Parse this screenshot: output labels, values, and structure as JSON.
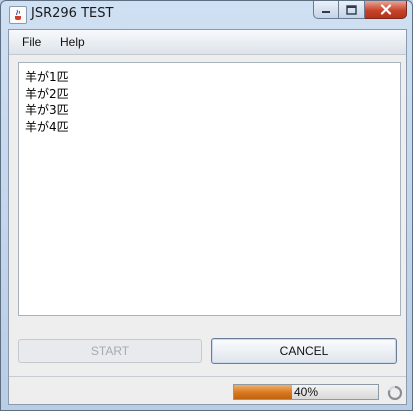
{
  "window": {
    "title": "JSR296 TEST"
  },
  "menu": {
    "items": [
      "File",
      "Help"
    ]
  },
  "log": {
    "lines": [
      "羊が1匹",
      "羊が2匹",
      "羊が3匹",
      "羊が4匹"
    ]
  },
  "buttons": {
    "start": "START",
    "cancel": "CANCEL",
    "start_enabled": false
  },
  "status": {
    "progress_text": "40%",
    "progress_value": 0.4
  },
  "colors": {
    "progress_fill": "#d7771f",
    "close_button": "#c7442b",
    "title_bar": "#cfe0f3"
  },
  "icons": {
    "app": "java-cup-icon",
    "minimize": "minimize-icon",
    "maximize": "maximize-icon",
    "close": "close-icon",
    "busy": "busy-spinner-icon"
  }
}
